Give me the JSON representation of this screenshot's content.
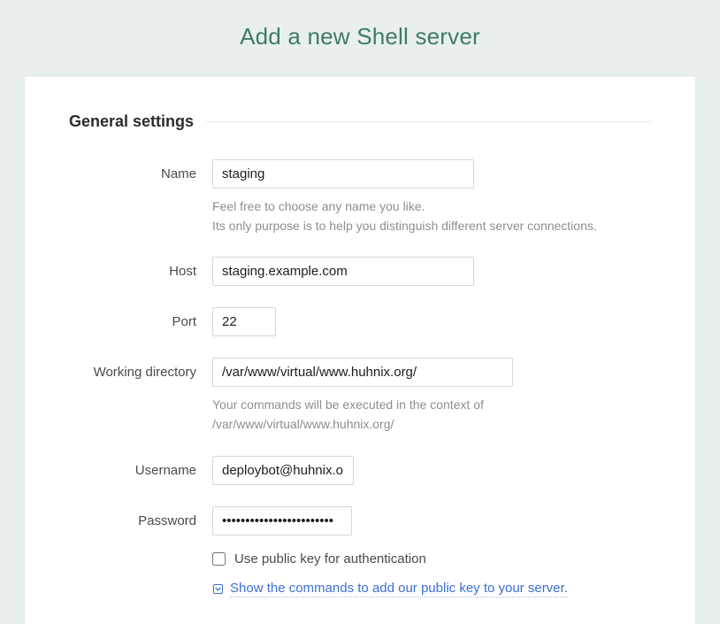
{
  "page": {
    "title": "Add a new Shell server"
  },
  "section": {
    "title": "General settings"
  },
  "fields": {
    "name": {
      "label": "Name",
      "value": "staging",
      "hint1": "Feel free to choose any name you like.",
      "hint2": "Its only purpose is to help you distinguish different server connections."
    },
    "host": {
      "label": "Host",
      "value": "staging.example.com"
    },
    "port": {
      "label": "Port",
      "value": "22"
    },
    "workdir": {
      "label": "Working directory",
      "value": "/var/www/virtual/www.huhnix.org/",
      "hint": "Your commands will be executed in the context of /var/www/virtual/www.huhnix.org/"
    },
    "username": {
      "label": "Username",
      "value": "deploybot@huhnix.org"
    },
    "password": {
      "label": "Password",
      "value": "••••••••••••••••••••••••",
      "pubkey_label": "Use public key for authentication",
      "show_cmd_link": "Show the commands to add our public key to your server."
    }
  }
}
